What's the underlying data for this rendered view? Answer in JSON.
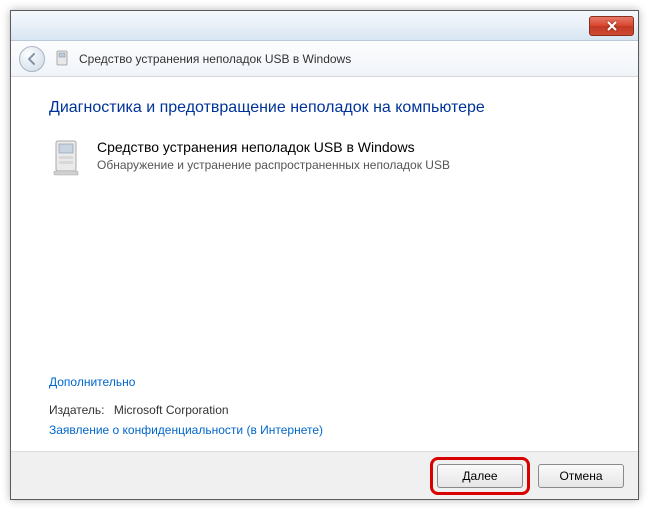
{
  "header": {
    "title": "Средство устранения неполадок USB в Windows"
  },
  "content": {
    "heading": "Диагностика и предотвращение неполадок на компьютере",
    "tool_title": "Средство устранения неполадок USB в Windows",
    "tool_desc": "Обнаружение и устранение распространенных неполадок USB",
    "advanced_link": "Дополнительно",
    "publisher_label": "Издатель:",
    "publisher_value": "Microsoft Corporation",
    "privacy_link": "Заявление о конфиденциальности (в Интернете)"
  },
  "footer": {
    "next_label": "Далее",
    "cancel_label": "Отмена"
  }
}
